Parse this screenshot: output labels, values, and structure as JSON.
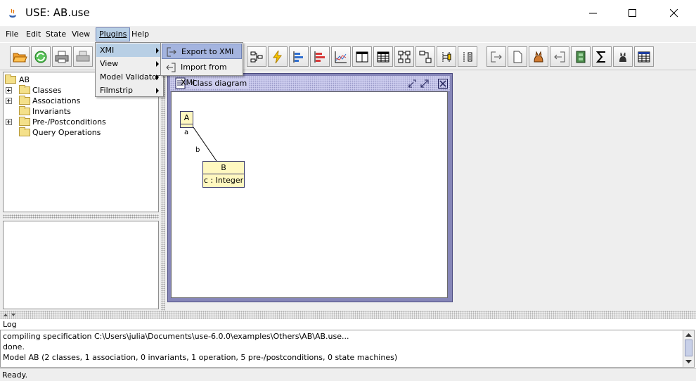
{
  "window": {
    "title": "USE: AB.use"
  },
  "menubar": {
    "items": [
      {
        "label": "File"
      },
      {
        "label": "Edit"
      },
      {
        "label": "State"
      },
      {
        "label": "View"
      },
      {
        "label": "Plugins"
      },
      {
        "label": "Help"
      }
    ]
  },
  "plugins_menu": {
    "items": [
      {
        "label": "XMI"
      },
      {
        "label": "View"
      },
      {
        "label": "Model Validator"
      },
      {
        "label": "Filmstrip"
      }
    ]
  },
  "xmi_submenu": {
    "items": [
      {
        "label": "Export to XMI"
      },
      {
        "label": "Import from XMI"
      }
    ]
  },
  "toolbar": {
    "icons": [
      "open-icon",
      "reload-icon",
      "print-icon",
      "print-view-icon",
      "class-hierarchy-icon",
      "lightning-icon",
      "bar-chart-blue-icon",
      "bar-chart-red-icon",
      "line-chart-icon",
      "table-layout-icon",
      "table-icon",
      "object-diagram-icon",
      "class-diagram-icon",
      "sequence-icon",
      "communication-icon",
      "export-icon",
      "new-document-icon",
      "cat-icon",
      "import-icon",
      "film-icon",
      "sigma-icon",
      "cat-small-icon",
      "grid-icon"
    ]
  },
  "tree": {
    "root": "AB",
    "children": [
      {
        "label": "Classes",
        "expandable": true
      },
      {
        "label": "Associations",
        "expandable": true
      },
      {
        "label": "Invariants",
        "expandable": false
      },
      {
        "label": "Pre-/Postconditions",
        "expandable": true
      },
      {
        "label": "Query Operations",
        "expandable": false
      }
    ]
  },
  "diagram": {
    "title": "Class diagram",
    "class_a": {
      "name": "A"
    },
    "class_b": {
      "name": "B",
      "attribute": "c : Integer"
    },
    "assoc_labels": {
      "role_a": "a",
      "role_b": "b"
    }
  },
  "log": {
    "label": "Log",
    "lines": [
      "compiling specification C:\\Users\\julia\\Documents\\use-6.0.0\\examples\\Others\\AB\\AB.use...",
      "done.",
      "Model AB (2 classes, 1 association, 0 invariants, 1 operation, 5 pre-/postconditions, 0 state machines)"
    ]
  },
  "status": {
    "text": "Ready."
  },
  "colors": {
    "menu_highlight": "#b8cfe5",
    "frame_border": "#8686b8",
    "class_fill": "#fff8c0"
  }
}
